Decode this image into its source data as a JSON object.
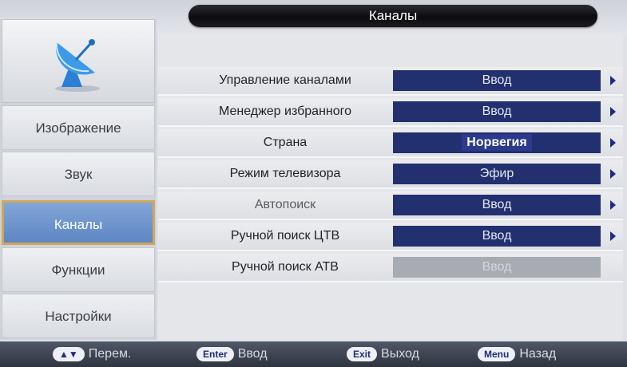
{
  "header": {
    "title": "Каналы"
  },
  "sidebar": {
    "logo_icon": "satellite-dish-icon",
    "items": [
      {
        "id": "picture",
        "label": "Изображение",
        "active": false
      },
      {
        "id": "sound",
        "label": "Звук",
        "active": false
      },
      {
        "id": "channels",
        "label": "Каналы",
        "active": true
      },
      {
        "id": "features",
        "label": "Функции",
        "active": false
      },
      {
        "id": "settings",
        "label": "Настройки",
        "active": false
      }
    ]
  },
  "menu": {
    "rows": [
      {
        "label": "Управление каналами",
        "value": "Ввод",
        "arrow": true,
        "enabled": true,
        "selected": false
      },
      {
        "label": "Менеджер избранного",
        "value": "Ввод",
        "arrow": true,
        "enabled": true,
        "selected": false
      },
      {
        "label": "Страна",
        "value": "Норвегия",
        "arrow": true,
        "enabled": true,
        "selected": true
      },
      {
        "label": "Режим телевизора",
        "value": "Эфир",
        "arrow": true,
        "enabled": true,
        "selected": false
      },
      {
        "label": "Автопоиск",
        "value": "Ввод",
        "arrow": true,
        "enabled": true,
        "selected": false
      },
      {
        "label": "Ручной поиск ЦТВ",
        "value": "Ввод",
        "arrow": true,
        "enabled": true,
        "selected": false
      },
      {
        "label": "Ручной поиск АТВ",
        "value": "Ввод",
        "arrow": false,
        "enabled": false,
        "selected": false
      }
    ]
  },
  "footer": {
    "hints": [
      {
        "key": "▲▼",
        "label": "Перем."
      },
      {
        "key": "Enter",
        "label": "Ввод"
      },
      {
        "key": "Exit",
        "label": "Выход"
      },
      {
        "key": "Menu",
        "label": "Назад"
      }
    ]
  },
  "colors": {
    "value_bg": "#23306f",
    "active_nav": "#6f95cf",
    "active_border": "#d1a75a",
    "disabled_value": "#a8abb3"
  }
}
